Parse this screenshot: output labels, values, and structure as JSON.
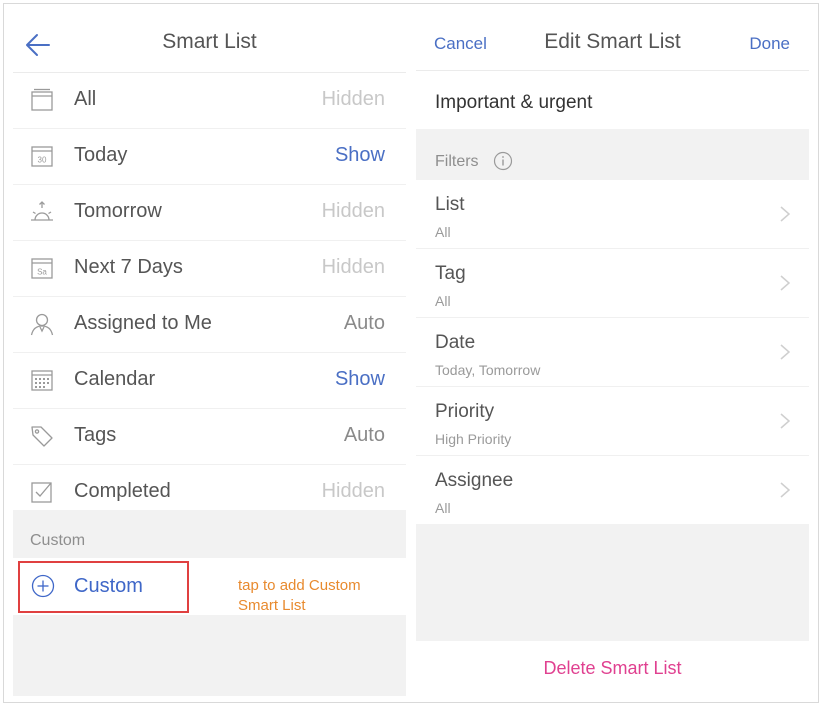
{
  "left": {
    "title": "Smart List",
    "items": [
      {
        "label": "All",
        "status": "Hidden"
      },
      {
        "label": "Today",
        "status": "Show"
      },
      {
        "label": "Tomorrow",
        "status": "Hidden"
      },
      {
        "label": "Next 7 Days",
        "status": "Hidden"
      },
      {
        "label": "Assigned to Me",
        "status": "Auto"
      },
      {
        "label": "Calendar",
        "status": "Show"
      },
      {
        "label": "Tags",
        "status": "Auto"
      },
      {
        "label": "Completed",
        "status": "Hidden"
      }
    ],
    "today_icon_text": "30",
    "next7_icon_text": "Sa",
    "section_label": "Custom",
    "custom_label": "Custom",
    "annotation_line1": "tap to add Custom",
    "annotation_line2": "Smart List"
  },
  "right": {
    "cancel_label": "Cancel",
    "title": "Edit Smart List",
    "done_label": "Done",
    "list_name": "Important & urgent",
    "filters_label": "Filters",
    "filters": [
      {
        "name": "List",
        "value": "All"
      },
      {
        "name": "Tag",
        "value": "All"
      },
      {
        "name": "Date",
        "value": "Today, Tomorrow"
      },
      {
        "name": "Priority",
        "value": "High Priority"
      },
      {
        "name": "Assignee",
        "value": "All"
      }
    ],
    "delete_label": "Delete Smart List"
  },
  "colors": {
    "accent_blue": "#4a6fc4",
    "hidden_gray": "#c8c8c8",
    "auto_gray": "#8a8a8a",
    "highlight_red": "#e04040",
    "annotation_orange": "#e88a2e",
    "delete_pink": "#e04090"
  },
  "icons": [
    "back-arrow-icon",
    "inbox-icon",
    "calendar-30-icon",
    "sunrise-icon",
    "calendar-sa-icon",
    "person-icon",
    "calendar-grid-icon",
    "tag-icon",
    "checkbox-icon",
    "plus-circle-icon",
    "info-icon",
    "chevron-right-icon"
  ]
}
